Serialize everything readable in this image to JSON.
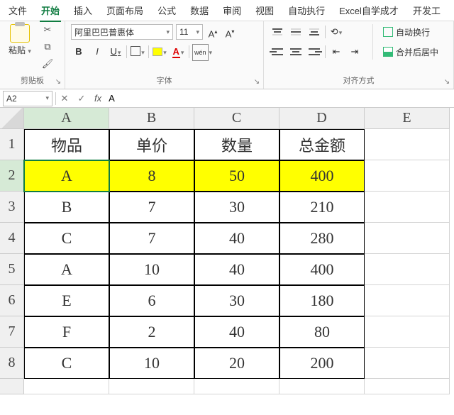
{
  "tabs": [
    "文件",
    "开始",
    "插入",
    "页面布局",
    "公式",
    "数据",
    "审阅",
    "视图",
    "自动执行",
    "Excel自学成才",
    "开发工"
  ],
  "active_tab_index": 1,
  "ribbon": {
    "clipboard": {
      "paste": "粘贴",
      "label": "剪贴板"
    },
    "font": {
      "name": "阿里巴巴普惠体",
      "size": "11",
      "bold": "B",
      "italic": "I",
      "underline": "U",
      "label": "字体"
    },
    "align": {
      "wrap": "自动换行",
      "merge": "合并后居中",
      "label": "对齐方式"
    }
  },
  "namebox": "A2",
  "formula": "A",
  "columns": [
    "A",
    "B",
    "C",
    "D",
    "E"
  ],
  "rows": [
    "1",
    "2",
    "3",
    "4",
    "5",
    "6",
    "7",
    "8"
  ],
  "headers": [
    "物品",
    "单价",
    "数量",
    "总金额"
  ],
  "data": [
    [
      "A",
      "8",
      "50",
      "400"
    ],
    [
      "B",
      "7",
      "30",
      "210"
    ],
    [
      "C",
      "7",
      "40",
      "280"
    ],
    [
      "A",
      "10",
      "40",
      "400"
    ],
    [
      "E",
      "6",
      "30",
      "180"
    ],
    [
      "F",
      "2",
      "40",
      "80"
    ],
    [
      "C",
      "10",
      "20",
      "200"
    ]
  ],
  "selected_cell": "A2",
  "highlight_row": 0
}
